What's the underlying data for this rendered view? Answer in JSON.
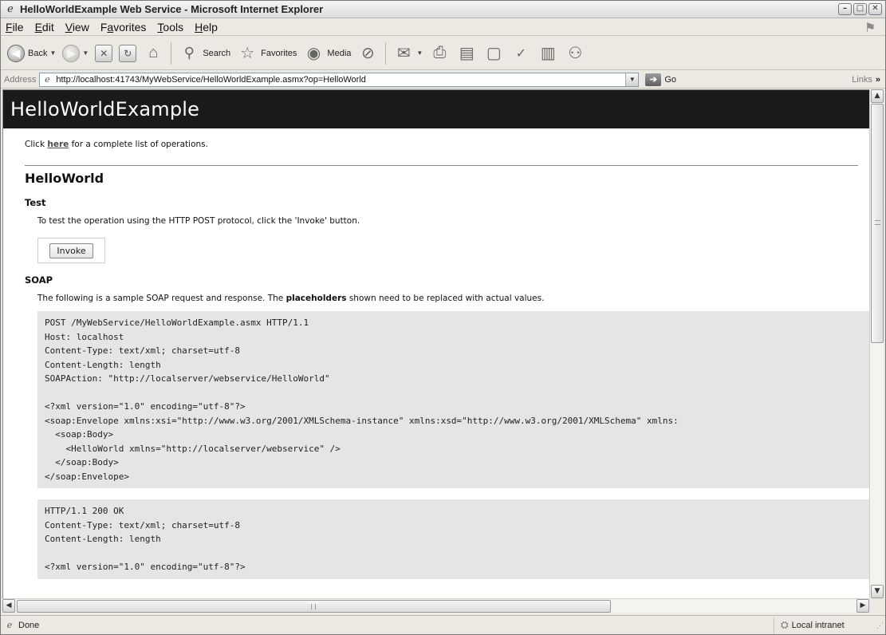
{
  "window": {
    "title": "HelloWorldExample Web Service - Microsoft Internet Explorer",
    "buttons": {
      "minimize": "–",
      "maximize": "□",
      "close": "✕"
    }
  },
  "menu": {
    "items": [
      {
        "first": "F",
        "rest": "ile"
      },
      {
        "first": "E",
        "rest": "dit"
      },
      {
        "first": "V",
        "rest": "iew"
      },
      {
        "first": "Fa",
        "rest": "vorites",
        "underline_index": 1
      },
      {
        "first": "T",
        "rest": "ools"
      },
      {
        "first": "H",
        "rest": "elp"
      }
    ]
  },
  "toolbar": {
    "back_label": "Back",
    "search_label": "Search",
    "favorites_label": "Favorites",
    "media_label": "Media"
  },
  "address": {
    "label": "Address",
    "url": "http://localhost:41743/MyWebService/HelloWorldExample.asmx?op=HelloWorld",
    "go_label": "Go",
    "links_label": "Links"
  },
  "page": {
    "service_name": "HelloWorldExample",
    "intro_prefix": "Click ",
    "intro_link": "here",
    "intro_suffix": " for a complete list of operations.",
    "operation_name": "HelloWorld",
    "test_heading": "Test",
    "test_text": "To test the operation using the HTTP POST protocol, click the 'Invoke' button.",
    "invoke_label": "Invoke",
    "soap_heading": "SOAP",
    "soap_text_before": "The following is a sample SOAP request and response. The ",
    "soap_text_bold": "placeholders",
    "soap_text_after": " shown need to be replaced with actual values.",
    "request_code": "POST /MyWebService/HelloWorldExample.asmx HTTP/1.1\nHost: localhost\nContent-Type: text/xml; charset=utf-8\nContent-Length: length\nSOAPAction: \"http://localserver/webservice/HelloWorld\"\n\n<?xml version=\"1.0\" encoding=\"utf-8\"?>\n<soap:Envelope xmlns:xsi=\"http://www.w3.org/2001/XMLSchema-instance\" xmlns:xsd=\"http://www.w3.org/2001/XMLSchema\" xmlns:\n  <soap:Body>\n    <HelloWorld xmlns=\"http://localserver/webservice\" />\n  </soap:Body>\n</soap:Envelope>",
    "response_code": "HTTP/1.1 200 OK\nContent-Type: text/xml; charset=utf-8\nContent-Length: length\n\n<?xml version=\"1.0\" encoding=\"utf-8\"?>"
  },
  "status": {
    "text": "Done",
    "zone": "Local intranet"
  },
  "colors": {
    "banner": "#1a1a1a",
    "code_bg": "#e5e5e5",
    "link": "#4a4a4a"
  }
}
